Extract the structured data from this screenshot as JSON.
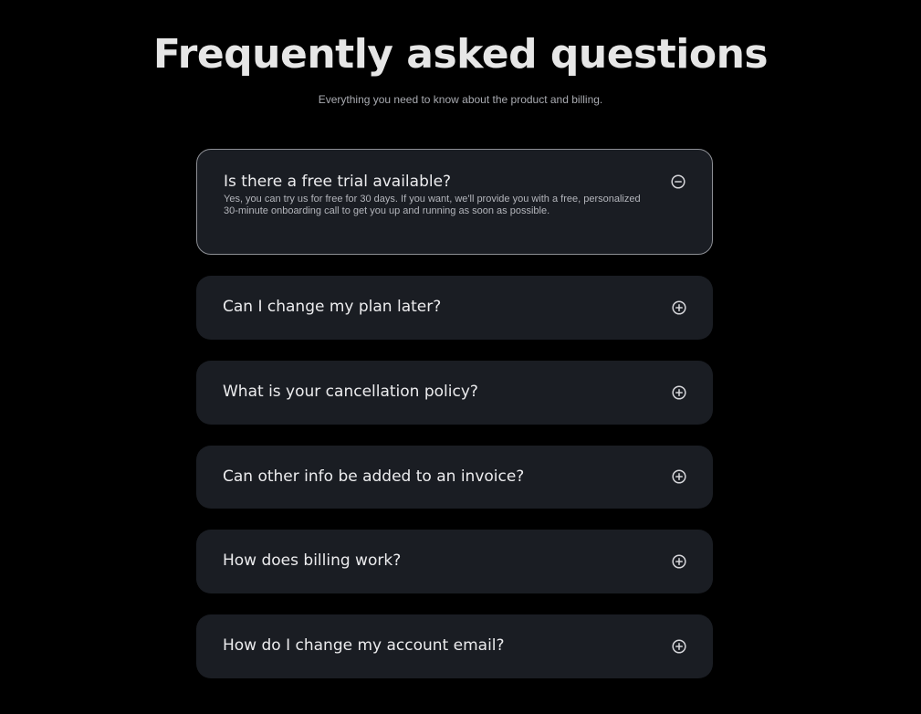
{
  "header": {
    "title": "Frequently asked questions",
    "subtitle": "Everything you need to know about the product and billing."
  },
  "faq": {
    "items": [
      {
        "question": "Is there a free trial available?",
        "answer": "Yes, you can try us for free for 30 days. If you want, we'll provide you with a free, personalized 30-minute onboarding call to get you up and running as soon as possible.",
        "expanded": true,
        "icon": "minus-circle-icon"
      },
      {
        "question": "Can I change my plan later?",
        "expanded": false,
        "icon": "plus-circle-icon"
      },
      {
        "question": "What is your cancellation policy?",
        "expanded": false,
        "icon": "plus-circle-icon"
      },
      {
        "question": "Can other info be added to an invoice?",
        "expanded": false,
        "icon": "plus-circle-icon"
      },
      {
        "question": "How does billing work?",
        "expanded": false,
        "icon": "plus-circle-icon"
      },
      {
        "question": "How do I change my account email?",
        "expanded": false,
        "icon": "plus-circle-icon"
      }
    ]
  },
  "colors": {
    "background": "#000000",
    "card": "#1a1d23",
    "open_border": "#8d8f95",
    "text_primary": "#ececee",
    "text_secondary": "#b3b5bb"
  }
}
